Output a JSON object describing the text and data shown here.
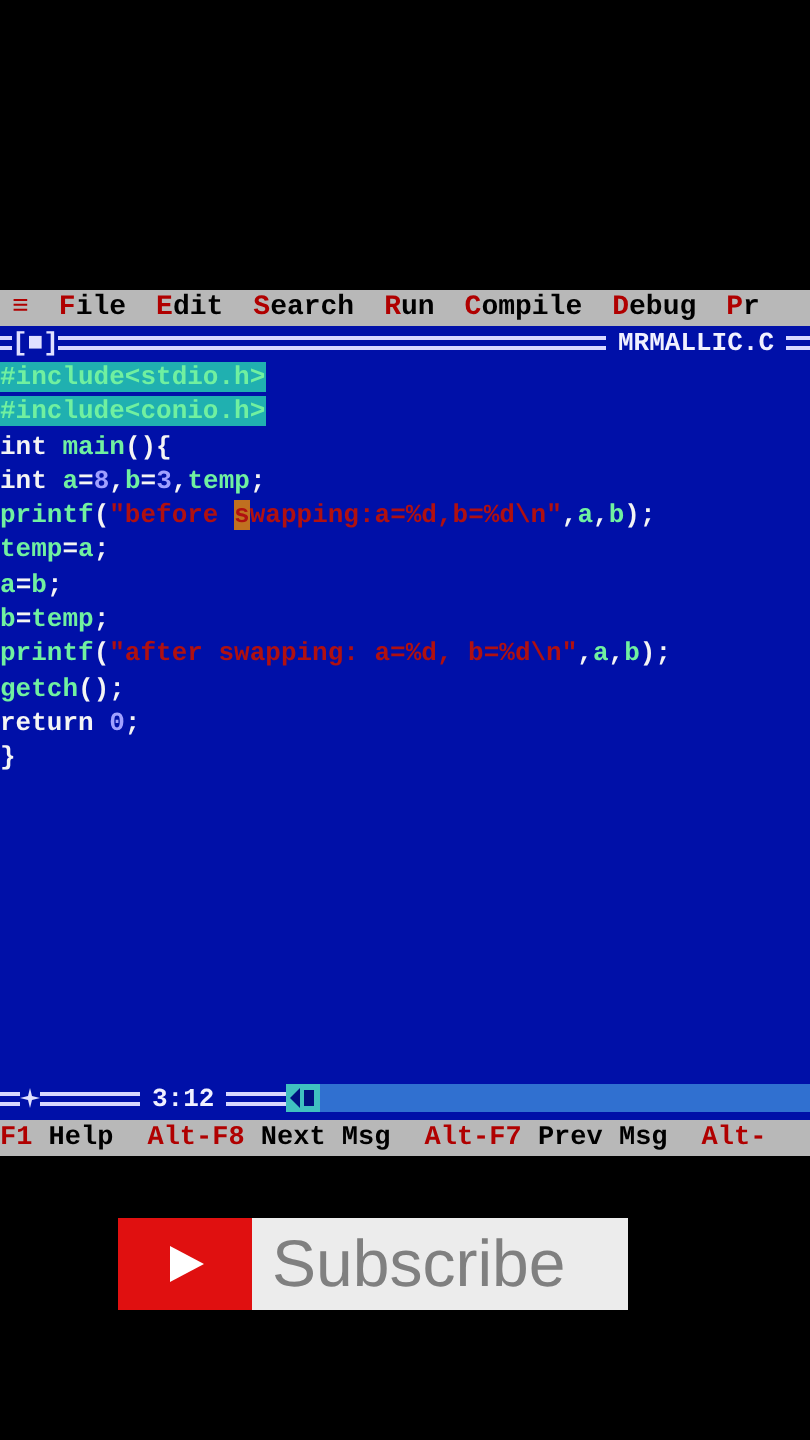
{
  "menu_bar": {
    "items": [
      {
        "hotkey": "≡"
      },
      {
        "hotkey": "F",
        "rest": "ile"
      },
      {
        "hotkey": "E",
        "rest": "dit"
      },
      {
        "hotkey": "S",
        "rest": "earch"
      },
      {
        "hotkey": "R",
        "rest": "un"
      },
      {
        "hotkey": "C",
        "rest": "ompile"
      },
      {
        "hotkey": "D",
        "rest": "ebug"
      },
      {
        "hotkey": "P",
        "rest": "r"
      }
    ]
  },
  "editor": {
    "close_box": "[■]",
    "file_name": "MRMALLIC.C",
    "lines": [
      {
        "selected": true,
        "tokens": [
          {
            "kind": "ident",
            "text": "#include<stdio.h>"
          }
        ]
      },
      {
        "selected": true,
        "tokens": [
          {
            "kind": "ident",
            "text": "#include<conio.h>"
          }
        ]
      },
      {
        "selected": false,
        "tokens": [
          {
            "kind": "keyword",
            "text": "int "
          },
          {
            "kind": "ident",
            "text": "main"
          },
          {
            "kind": "punct",
            "text": "(){"
          }
        ]
      },
      {
        "selected": false,
        "tokens": [
          {
            "kind": "keyword",
            "text": "int "
          },
          {
            "kind": "ident",
            "text": "a"
          },
          {
            "kind": "punct",
            "text": "="
          },
          {
            "kind": "number",
            "text": "8"
          },
          {
            "kind": "punct",
            "text": ","
          },
          {
            "kind": "ident",
            "text": "b"
          },
          {
            "kind": "punct",
            "text": "="
          },
          {
            "kind": "number",
            "text": "3"
          },
          {
            "kind": "punct",
            "text": ","
          },
          {
            "kind": "ident",
            "text": "temp"
          },
          {
            "kind": "punct",
            "text": ";"
          }
        ]
      },
      {
        "selected": false,
        "tokens": [
          {
            "kind": "ident",
            "text": "printf"
          },
          {
            "kind": "punct",
            "text": "("
          },
          {
            "kind": "string",
            "text": "\"before "
          },
          {
            "kind": "cursor",
            "text": "s"
          },
          {
            "kind": "string",
            "text": "wapping:a=%d,b=%d\\n\""
          },
          {
            "kind": "punct",
            "text": ","
          },
          {
            "kind": "ident",
            "text": "a"
          },
          {
            "kind": "punct",
            "text": ","
          },
          {
            "kind": "ident",
            "text": "b"
          },
          {
            "kind": "punct",
            "text": ");"
          }
        ]
      },
      {
        "selected": false,
        "tokens": [
          {
            "kind": "ident",
            "text": "temp"
          },
          {
            "kind": "punct",
            "text": "="
          },
          {
            "kind": "ident",
            "text": "a"
          },
          {
            "kind": "punct",
            "text": ";"
          }
        ]
      },
      {
        "selected": false,
        "tokens": [
          {
            "kind": "ident",
            "text": "a"
          },
          {
            "kind": "punct",
            "text": "="
          },
          {
            "kind": "ident",
            "text": "b"
          },
          {
            "kind": "punct",
            "text": ";"
          }
        ]
      },
      {
        "selected": false,
        "tokens": [
          {
            "kind": "ident",
            "text": "b"
          },
          {
            "kind": "punct",
            "text": "="
          },
          {
            "kind": "ident",
            "text": "temp"
          },
          {
            "kind": "punct",
            "text": ";"
          }
        ]
      },
      {
        "selected": false,
        "tokens": [
          {
            "kind": "ident",
            "text": "printf"
          },
          {
            "kind": "punct",
            "text": "("
          },
          {
            "kind": "string",
            "text": "\"after swapping: a=%d, b=%d\\n\""
          },
          {
            "kind": "punct",
            "text": ","
          },
          {
            "kind": "ident",
            "text": "a"
          },
          {
            "kind": "punct",
            "text": ","
          },
          {
            "kind": "ident",
            "text": "b"
          },
          {
            "kind": "punct",
            "text": ");"
          }
        ]
      },
      {
        "selected": false,
        "tokens": [
          {
            "kind": "ident",
            "text": "getch"
          },
          {
            "kind": "punct",
            "text": "();"
          }
        ]
      },
      {
        "selected": false,
        "tokens": [
          {
            "kind": "keyword",
            "text": "return "
          },
          {
            "kind": "number",
            "text": "0"
          },
          {
            "kind": "punct",
            "text": ";"
          }
        ]
      },
      {
        "selected": false,
        "tokens": [
          {
            "kind": "punct",
            "text": "}"
          }
        ]
      }
    ],
    "cursor_position": "3:12"
  },
  "function_keys": [
    {
      "key": "F1",
      "label": "Help"
    },
    {
      "key": "Alt-F8",
      "label": "Next Msg"
    },
    {
      "key": "Alt-F7",
      "label": "Prev Msg"
    },
    {
      "key": "Alt-"
    }
  ],
  "subscribe_button": {
    "label": "Subscribe"
  }
}
